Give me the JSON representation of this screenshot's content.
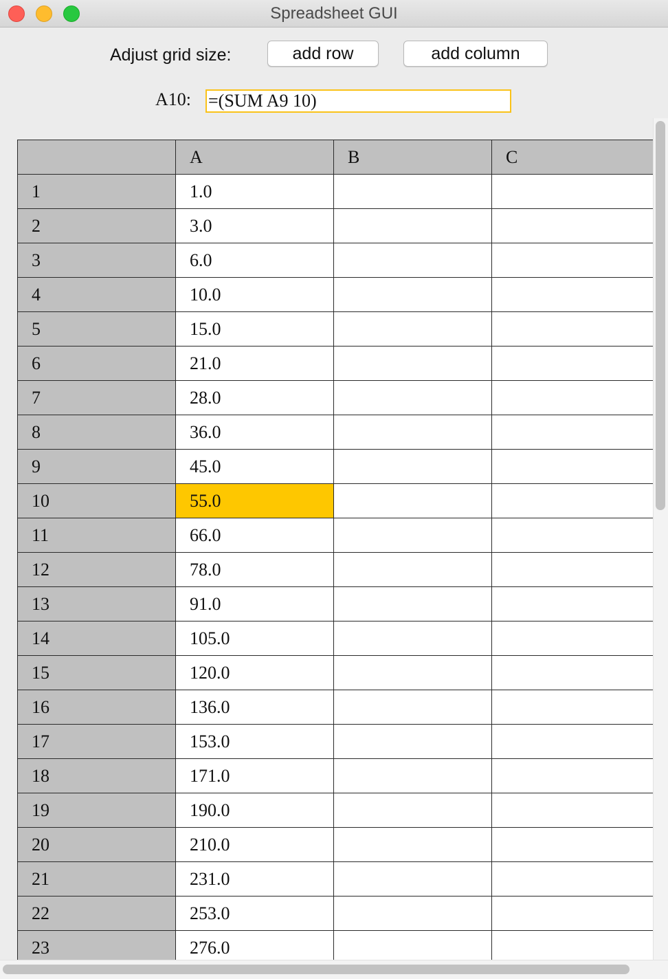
{
  "window": {
    "title": "Spreadsheet GUI"
  },
  "toolbar": {
    "adjust_label": "Adjust grid size:",
    "add_row_label": "add row",
    "add_column_label": "add column"
  },
  "formula_bar": {
    "cell_ref": "A10:",
    "value": "=(SUM A9 10)"
  },
  "colors": {
    "selected_cell": "#fec700",
    "formula_border": "#fac219",
    "header_bg": "#c0c0c0"
  },
  "grid": {
    "columns": [
      "",
      "A",
      "B",
      "C"
    ],
    "selected": {
      "row": "10",
      "col": "A"
    },
    "rows": [
      {
        "label": "1",
        "cells": [
          "1.0",
          "",
          ""
        ]
      },
      {
        "label": "2",
        "cells": [
          "3.0",
          "",
          ""
        ]
      },
      {
        "label": "3",
        "cells": [
          "6.0",
          "",
          ""
        ]
      },
      {
        "label": "4",
        "cells": [
          "10.0",
          "",
          ""
        ]
      },
      {
        "label": "5",
        "cells": [
          "15.0",
          "",
          ""
        ]
      },
      {
        "label": "6",
        "cells": [
          "21.0",
          "",
          ""
        ]
      },
      {
        "label": "7",
        "cells": [
          "28.0",
          "",
          ""
        ]
      },
      {
        "label": "8",
        "cells": [
          "36.0",
          "",
          ""
        ]
      },
      {
        "label": "9",
        "cells": [
          "45.0",
          "",
          ""
        ]
      },
      {
        "label": "10",
        "cells": [
          "55.0",
          "",
          ""
        ]
      },
      {
        "label": "11",
        "cells": [
          "66.0",
          "",
          ""
        ]
      },
      {
        "label": "12",
        "cells": [
          "78.0",
          "",
          ""
        ]
      },
      {
        "label": "13",
        "cells": [
          "91.0",
          "",
          ""
        ]
      },
      {
        "label": "14",
        "cells": [
          "105.0",
          "",
          ""
        ]
      },
      {
        "label": "15",
        "cells": [
          "120.0",
          "",
          ""
        ]
      },
      {
        "label": "16",
        "cells": [
          "136.0",
          "",
          ""
        ]
      },
      {
        "label": "17",
        "cells": [
          "153.0",
          "",
          ""
        ]
      },
      {
        "label": "18",
        "cells": [
          "171.0",
          "",
          ""
        ]
      },
      {
        "label": "19",
        "cells": [
          "190.0",
          "",
          ""
        ]
      },
      {
        "label": "20",
        "cells": [
          "210.0",
          "",
          ""
        ]
      },
      {
        "label": "21",
        "cells": [
          "231.0",
          "",
          ""
        ]
      },
      {
        "label": "22",
        "cells": [
          "253.0",
          "",
          ""
        ]
      },
      {
        "label": "23",
        "cells": [
          "276.0",
          "",
          ""
        ]
      }
    ]
  }
}
